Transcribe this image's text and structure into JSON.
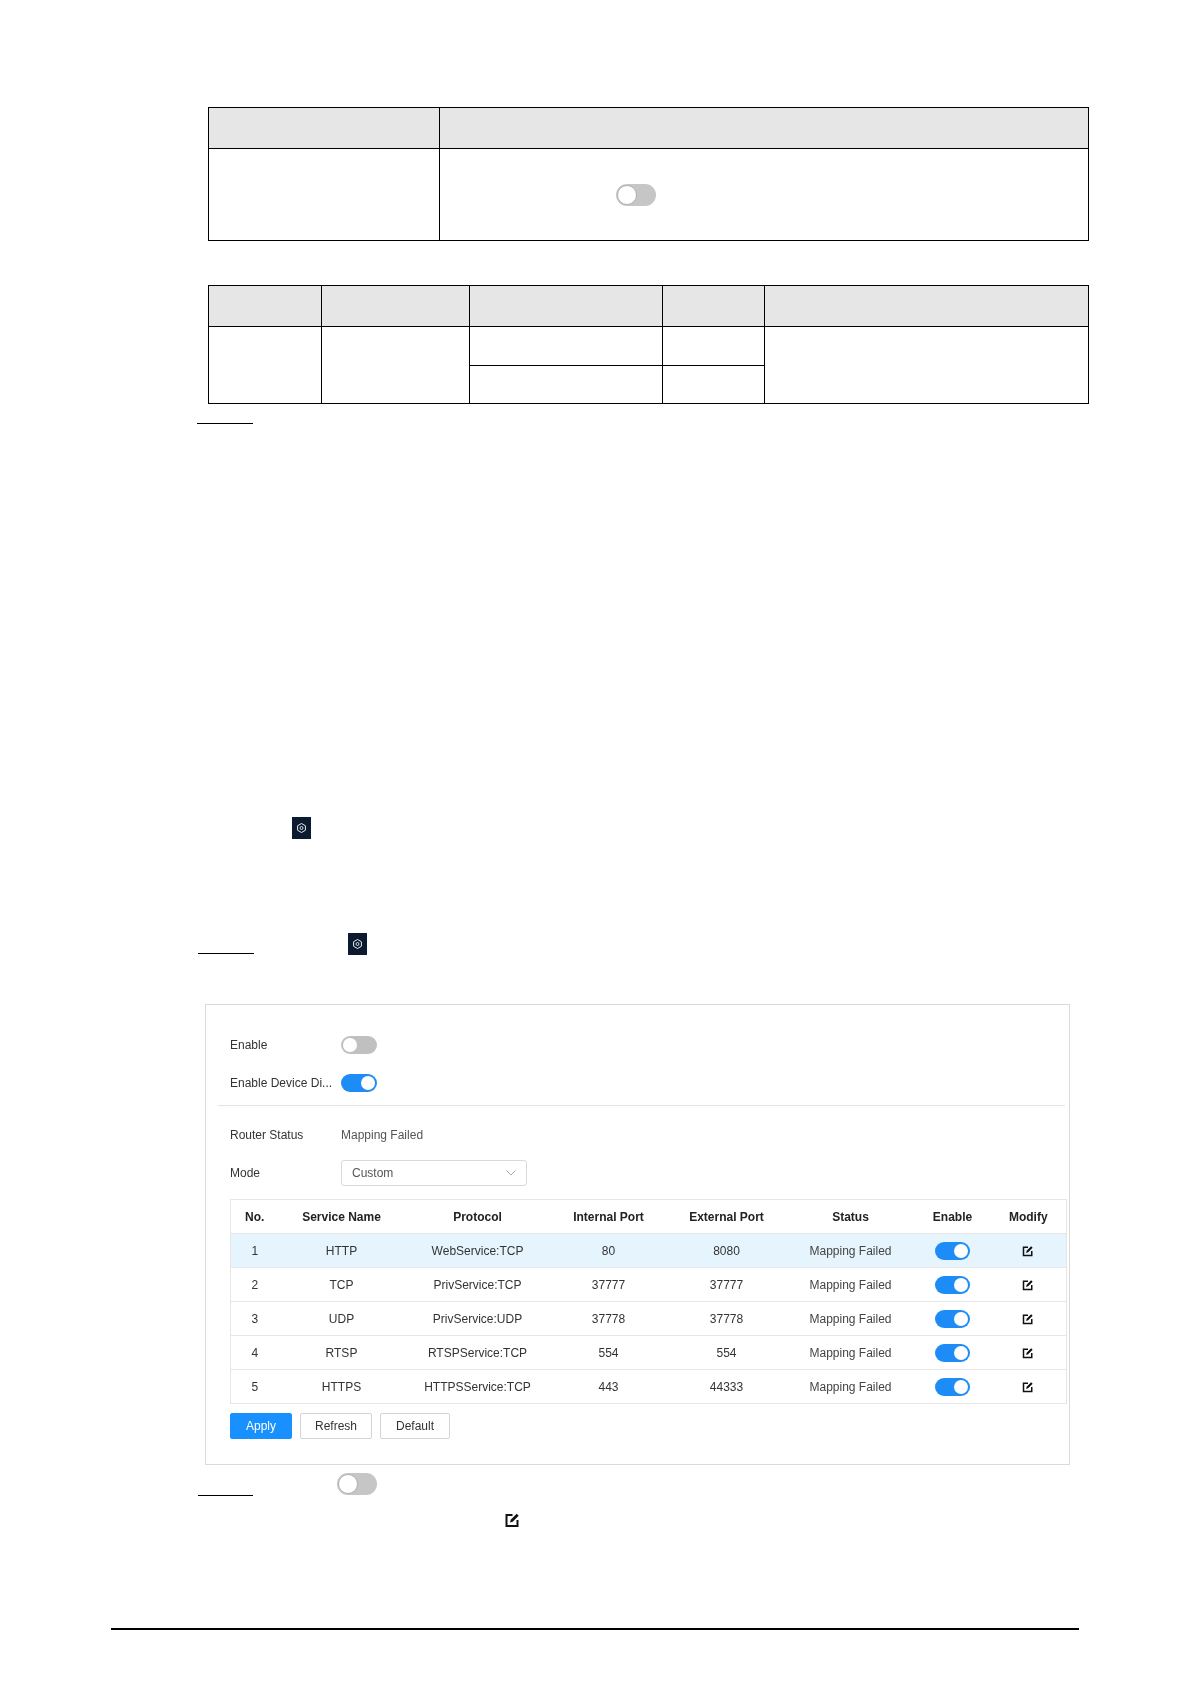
{
  "parameter_table": {
    "switch": {
      "on": false
    }
  },
  "settings_screenshot": {
    "switches": [
      {
        "label": "Enable",
        "on": false
      },
      {
        "label": "Enable Device Di...",
        "on": true
      }
    ],
    "router_status": {
      "label": "Router Status",
      "value": "Mapping Failed"
    },
    "mode": {
      "label": "Mode",
      "value": "Custom"
    },
    "table": {
      "columns": [
        "No.",
        "Service Name",
        "Protocol",
        "Internal Port",
        "External Port",
        "Status",
        "Enable",
        "Modify"
      ],
      "rows": [
        {
          "no": "1",
          "service_name": "HTTP",
          "protocol": "WebService:TCP",
          "internal_port": "80",
          "external_port": "8080",
          "status": "Mapping Failed",
          "enabled": true,
          "selected": true
        },
        {
          "no": "2",
          "service_name": "TCP",
          "protocol": "PrivService:TCP",
          "internal_port": "37777",
          "external_port": "37777",
          "status": "Mapping Failed",
          "enabled": true,
          "selected": false
        },
        {
          "no": "3",
          "service_name": "UDP",
          "protocol": "PrivService:UDP",
          "internal_port": "37778",
          "external_port": "37778",
          "status": "Mapping Failed",
          "enabled": true,
          "selected": false
        },
        {
          "no": "4",
          "service_name": "RTSP",
          "protocol": "RTSPService:TCP",
          "internal_port": "554",
          "external_port": "554",
          "status": "Mapping Failed",
          "enabled": true,
          "selected": false
        },
        {
          "no": "5",
          "service_name": "HTTPS",
          "protocol": "HTTPSService:TCP",
          "internal_port": "443",
          "external_port": "44333",
          "status": "Mapping Failed",
          "enabled": true,
          "selected": false
        }
      ]
    },
    "buttons": [
      {
        "label": "Apply",
        "kind": "primary"
      },
      {
        "label": "Refresh",
        "kind": "default"
      },
      {
        "label": "Default",
        "kind": "default"
      }
    ]
  },
  "step_switch": {
    "on": false
  }
}
